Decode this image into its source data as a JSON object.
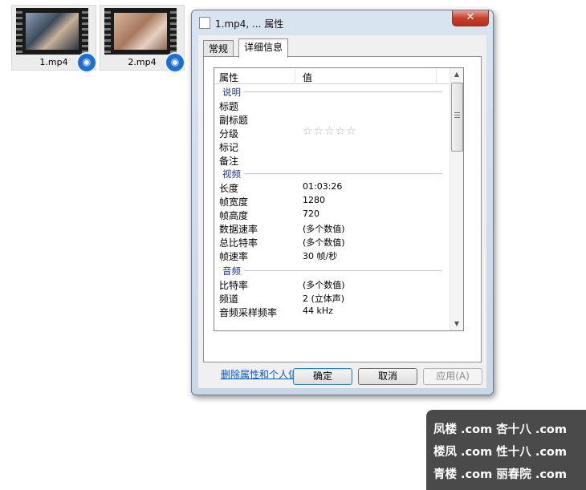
{
  "desktop": {
    "files": [
      {
        "name": "1.mp4",
        "badge_icon": "video-player-icon"
      },
      {
        "name": "2.mp4",
        "badge_icon": "video-player-icon"
      }
    ]
  },
  "dialog": {
    "title": "1.mp4, ... 属性",
    "close_glyph": "✕",
    "tabs": [
      {
        "label": "常规",
        "active": false
      },
      {
        "label": "详细信息",
        "active": true
      }
    ],
    "list": {
      "col_property": "属性",
      "col_value": "值",
      "groups": {
        "description": {
          "name": "说明",
          "rows": [
            {
              "key": "标题",
              "value": ""
            },
            {
              "key": "副标题",
              "value": ""
            },
            {
              "key": "分级",
              "value": ""
            },
            {
              "key": "标记",
              "value": ""
            },
            {
              "key": "备注",
              "value": ""
            }
          ],
          "rating": {
            "stars_filled": 0,
            "stars_total": 5
          }
        },
        "video": {
          "name": "视频",
          "rows": [
            {
              "key": "长度",
              "value": "01:03:26"
            },
            {
              "key": "帧宽度",
              "value": "1280"
            },
            {
              "key": "帧高度",
              "value": "720"
            },
            {
              "key": "数据速率",
              "value": "(多个数值)"
            },
            {
              "key": "总比特率",
              "value": "(多个数值)"
            },
            {
              "key": "帧速率",
              "value": "30 帧/秒"
            }
          ]
        },
        "audio": {
          "name": "音频",
          "rows": [
            {
              "key": "比特率",
              "value": "(多个数值)"
            },
            {
              "key": "频道",
              "value": "2 (立体声)"
            },
            {
              "key": "音频采样频率",
              "value": "44 kHz"
            }
          ]
        }
      }
    },
    "remove_link": "删除属性和个人信息",
    "buttons": {
      "ok": "确定",
      "cancel": "取消",
      "apply": "应用(A)"
    }
  },
  "watermark": {
    "lines": [
      "凤楼 .com  杏十八 .com",
      "楼凤 .com  性十八 .com",
      "青楼 .com  丽春院 .com"
    ]
  }
}
